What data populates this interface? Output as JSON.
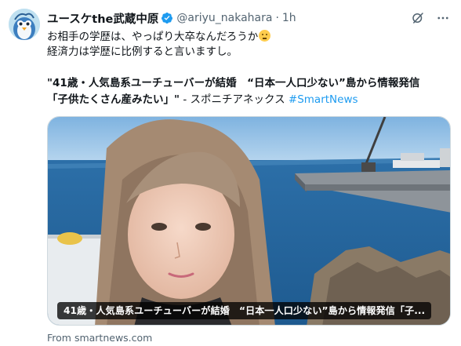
{
  "tweet": {
    "display_name": "ユースケthe武蔵中原",
    "handle": "@ariyu_nakahara",
    "separator": "·",
    "time": "1h",
    "verified": true,
    "avatar_icon": "penguin-avatar",
    "text_line1": "お相手の学歴は、やっぱり大卒なんだろうか",
    "text_emoji": "thinking-face-emoji",
    "text_line2": "経済力は学歴に比例すると言いますし。",
    "link_headline": "\"41歳・人気島系ユーチューバーが結婚　“日本一人口少ない”島から情報発信",
    "link_subheadline": "「子供たくさん産みたい」\"",
    "link_suffix": " - スポニチアネックス ",
    "hashtag": "#SmartNews"
  },
  "actions": {
    "grok_icon": "grok-icon",
    "more_icon": "more-options-icon"
  },
  "card": {
    "caption": "41歳・人気島系ユーチューバーが結婚　“日本一人口少ない”島から情報発信「子...",
    "source": "From smartnews.com"
  },
  "colors": {
    "text": "#0f1419",
    "secondary": "#536471",
    "link": "#1d9bf0",
    "verified": "#1d9bf0"
  }
}
